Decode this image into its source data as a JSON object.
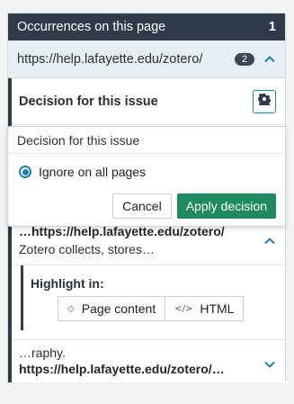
{
  "header": {
    "title": "Occurrences on this page",
    "count": "1"
  },
  "url_row": {
    "url": "https://help.lafayette.edu/zotero/",
    "badge": "2"
  },
  "decision": {
    "title": "Decision for this issue"
  },
  "popup": {
    "title": "Decision for this issue",
    "option_label": "Ignore on all pages",
    "cancel_label": "Cancel",
    "apply_label": "Apply decision"
  },
  "occurrence_2": {
    "url_text": "…https://help.lafayette.edu/zotero/",
    "snippet": "Zotero collects, stores…"
  },
  "highlight": {
    "label": "Highlight in:",
    "page_content_label": "Page content",
    "html_label": "HTML"
  },
  "occurrence_3": {
    "snippet": "…raphy.",
    "url_text": "https://help.lafayette.edu/zotero/…"
  },
  "colors": {
    "header_bg": "#2f3a4a",
    "accent": "#1f7fb8",
    "apply_bg": "#1f8a5f"
  },
  "icons": [
    "chevron-up-icon",
    "gear-icon",
    "eye-icon",
    "code-icon",
    "chevron-down-icon"
  ]
}
